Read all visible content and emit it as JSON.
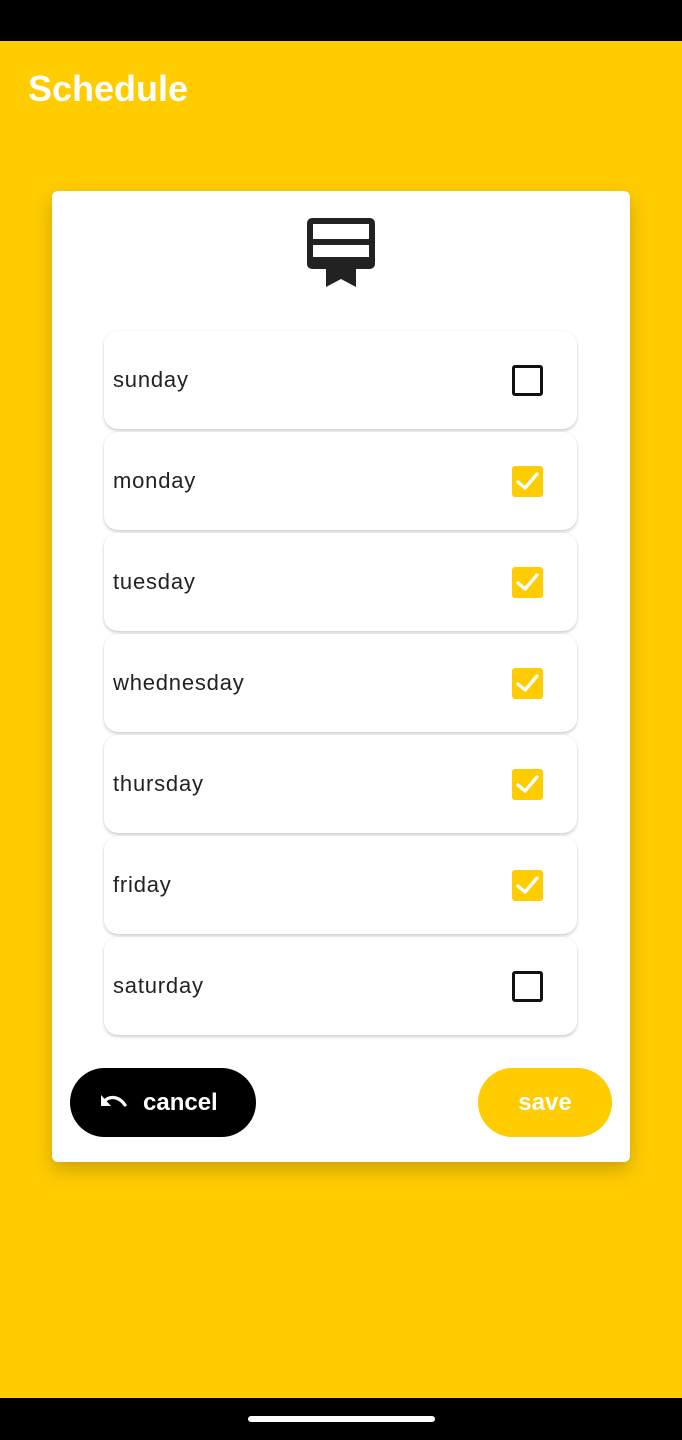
{
  "app": {
    "title": "Schedule"
  },
  "colors": {
    "accent": "#ffcc00",
    "dark": "#000000",
    "surface": "#ffffff"
  },
  "dialog": {
    "icon": "card-membership-icon",
    "days": [
      {
        "label": "sunday",
        "checked": false
      },
      {
        "label": "monday",
        "checked": true
      },
      {
        "label": "tuesday",
        "checked": true
      },
      {
        "label": "whednesday",
        "checked": true
      },
      {
        "label": "thursday",
        "checked": true
      },
      {
        "label": "friday",
        "checked": true
      },
      {
        "label": "saturday",
        "checked": false
      }
    ],
    "cancel_label": "cancel",
    "cancel_icon": "undo-icon",
    "save_label": "save"
  }
}
